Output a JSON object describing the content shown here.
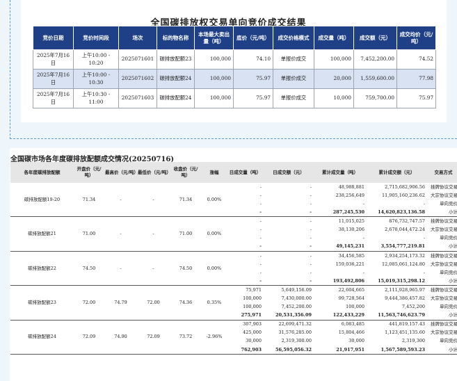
{
  "table1": {
    "title": "全国碳排放权交易单向竞价成交结果",
    "headers": [
      "竞价日期",
      "竞价时间段",
      "场次",
      "标的物名称",
      "本场最大卖出量（吨）",
      "底价（元/吨）",
      "成交价格模式",
      "成交量（吨）",
      "成交额（元）",
      "成交均价（元/吨）"
    ],
    "rows": [
      [
        "2025年7月16日",
        "上午10:00 - 10:20",
        "2025071601",
        "碳排放配额23",
        "100,000",
        "74.10",
        "单报价成交",
        "100,000",
        "7,452,200.00",
        "74.52"
      ],
      [
        "2025年7月16日",
        "上午10:00 - 10:30",
        "2025071602",
        "碳排放配额24",
        "100,000",
        "75.97",
        "单报价成交",
        "20,000",
        "1,559,600.00",
        "77.98"
      ],
      [
        "2025年7月16日",
        "上午10:30 - 11:00",
        "2025071603",
        "碳排放配额24",
        "100,000",
        "75.97",
        "单报价成交",
        "10,000",
        "759,700.00",
        "75.97"
      ]
    ]
  },
  "table2": {
    "title": "全国碳市场各年度碳排放配额成交情况(20250716)",
    "headers": [
      "各年度碳排放配额",
      "开盘价（元/吨）",
      "最高价（元/吨）",
      "最低价（元/吨）",
      "收盘价（元/吨）",
      "涨幅",
      "日成交量（吨）",
      "日成交额（元）",
      "累计成交量（吨）",
      "累计成交额（元）",
      "交易方式"
    ],
    "groups": [
      {
        "name": "碳排放配额19-20",
        "open": "71.34",
        "high": "-",
        "low": "-",
        "close": "71.34",
        "change": "0.00%",
        "rows": [
          [
            "-",
            "-",
            "48,988,881",
            "2,715,682,906.56",
            "挂牌协议交易"
          ],
          [
            "-",
            "-",
            "238,256,649",
            "11,905,160,236.62",
            "大宗协议交易"
          ],
          [
            "-",
            "-",
            "-",
            "-",
            "单向竞价"
          ],
          [
            "-",
            "-",
            "287,245,530",
            "14,620,823,136.58",
            "小计"
          ]
        ]
      },
      {
        "name": "碳排放配额21",
        "open": "71.00",
        "high": "-",
        "low": "-",
        "close": "71.00",
        "change": "0.00%",
        "rows": [
          [
            "-",
            "-",
            "11,015,025",
            "876,732,747.57",
            "挂牌协议交易"
          ],
          [
            "-",
            "-",
            "38,130,206",
            "2,678,044,472.24",
            "大宗协议交易"
          ],
          [
            "-",
            "-",
            "-",
            "-",
            "单向竞价"
          ],
          [
            "-",
            "-",
            "49,145,231",
            "3,554,777,219.81",
            "小计"
          ]
        ]
      },
      {
        "name": "碳排放配额22",
        "open": "74.50",
        "high": "-",
        "low": "-",
        "close": "74.50",
        "change": "0.00%",
        "rows": [
          [
            "-",
            "-",
            "34,456,585",
            "2,934,254,173.32",
            "挂牌协议交易"
          ],
          [
            "-",
            "-",
            "159,036,221",
            "12,085,061,124.80",
            "大宗协议交易"
          ],
          [
            "-",
            "-",
            "-",
            "-",
            "单向竞价"
          ],
          [
            "-",
            "-",
            "193,492,806",
            "15,019,315,298.12",
            "小计"
          ]
        ]
      },
      {
        "name": "碳排放配额23",
        "open": "72.00",
        "high": "74.79",
        "low": "72.00",
        "close": "74.36",
        "change": "0.35%",
        "rows": [
          [
            "75,971",
            "5,649,156.09",
            "22,604,665",
            "2,111,928,965.97",
            "挂牌协议交易"
          ],
          [
            "100,000",
            "7,430,000.00",
            "99,728,564",
            "9,444,386,457.82",
            "大宗协议交易"
          ],
          [
            "100,000",
            "7,452,200.00",
            "100,000",
            "7,452,200",
            "单向竞价"
          ],
          [
            "275,971",
            "20,531,356.09",
            "122,433,229",
            "11,563,746,623.79",
            "小计"
          ]
        ]
      },
      {
        "name": "碳排放配额24",
        "open": "72.09",
        "high": "74.90",
        "low": "72.09",
        "close": "73.72",
        "change": "-2.96%",
        "rows": [
          [
            "307,903",
            "22,699,471.32",
            "6,083,485",
            "441,819,157.43",
            "挂牌协议交易"
          ],
          [
            "425,000",
            "31,576,285.00",
            "15,804,466",
            "1,123,451,135.60",
            "大宗协议交易"
          ],
          [
            "30,000",
            "2,319,300.00",
            "30,000",
            "2,319,300",
            "单向竞价"
          ],
          [
            "762,903",
            "56,595,056.32",
            "21,917,951",
            "1,567,589,593.23",
            "小计"
          ]
        ]
      }
    ]
  }
}
